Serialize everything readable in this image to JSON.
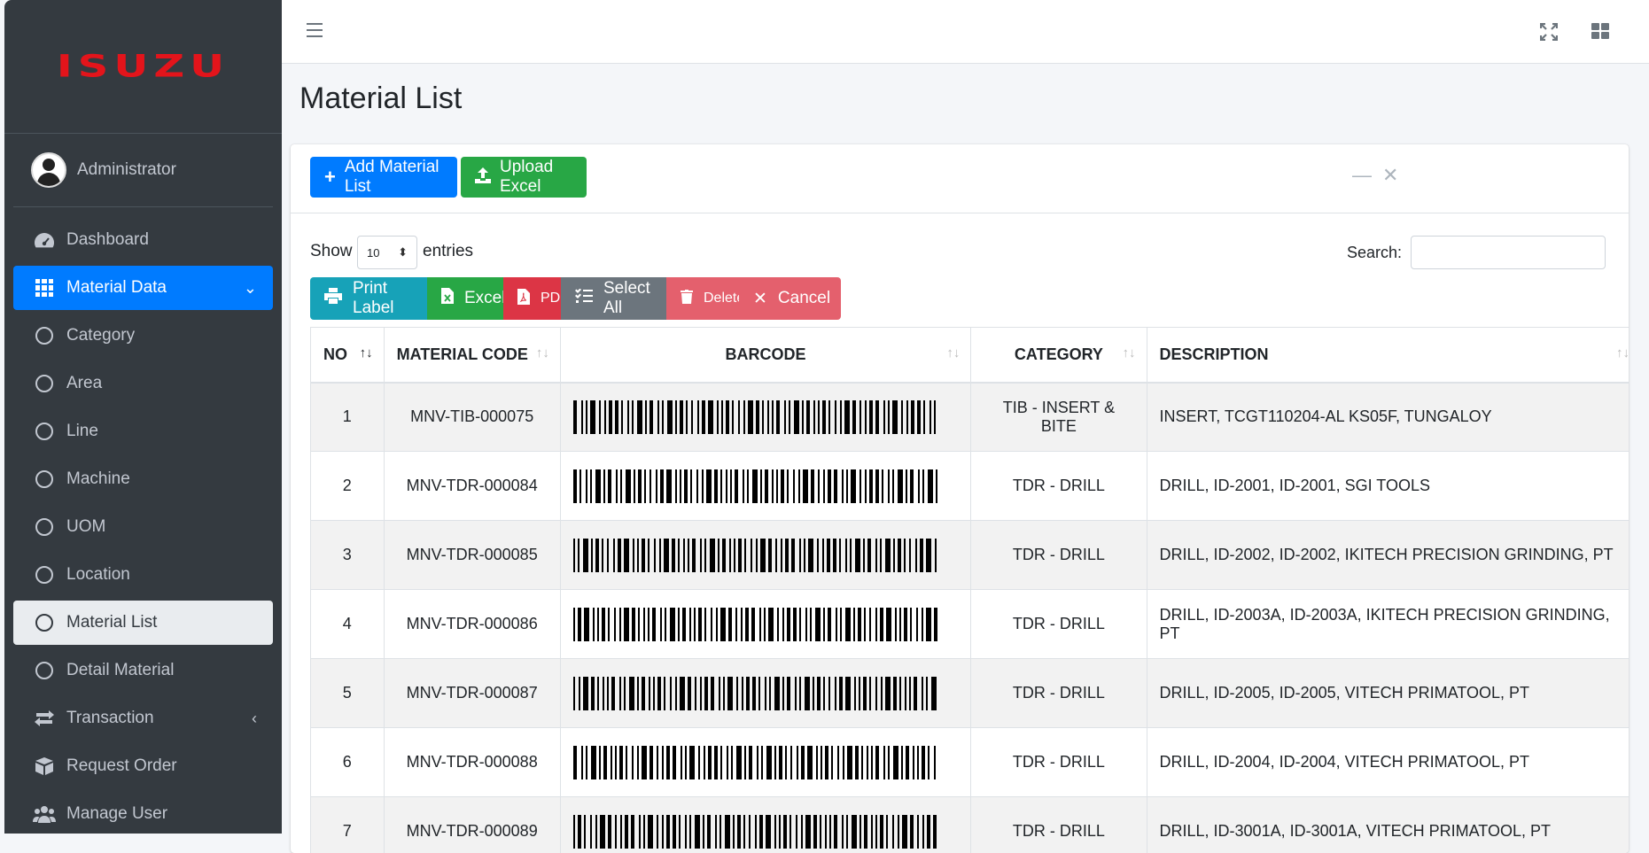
{
  "brand": {
    "logo_text": "ISUZU"
  },
  "user": {
    "name": "Administrator"
  },
  "sidebar": {
    "items": [
      {
        "label": "Dashboard",
        "icon": "tachometer-icon"
      },
      {
        "label": "Material Data",
        "icon": "grid-icon",
        "active": true
      },
      {
        "label": "Category",
        "icon": "circle-icon"
      },
      {
        "label": "Area",
        "icon": "circle-icon"
      },
      {
        "label": "Line",
        "icon": "circle-icon"
      },
      {
        "label": "Machine",
        "icon": "circle-icon"
      },
      {
        "label": "UOM",
        "icon": "circle-icon"
      },
      {
        "label": "Location",
        "icon": "circle-icon"
      },
      {
        "label": "Material List",
        "icon": "circle-icon",
        "selected": true
      },
      {
        "label": "Detail Material",
        "icon": "circle-icon"
      },
      {
        "label": "Transaction",
        "icon": "exchange-icon"
      },
      {
        "label": "Request Order",
        "icon": "box-icon"
      },
      {
        "label": "Manage User",
        "icon": "users-icon"
      }
    ]
  },
  "page": {
    "title": "Material List"
  },
  "card": {
    "add_label": "Add Material List",
    "upload_label": "Upload Excel"
  },
  "controls": {
    "show_label": "Show",
    "entries_value": "10",
    "entries_label": "entries",
    "search_label": "Search:",
    "search_value": ""
  },
  "dt_buttons": {
    "print": "Print Label",
    "excel": "Excel",
    "pdf": "PDF",
    "select_all": "Select All",
    "delete": "Delete",
    "cancel": "Cancel"
  },
  "table": {
    "headers": [
      "NO",
      "MATERIAL CODE",
      "BARCODE",
      "CATEGORY",
      "DESCRIPTION"
    ],
    "rows": [
      {
        "no": "1",
        "code": "MNV-TIB-000075",
        "category": "TIB - INSERT & BITE",
        "description": "INSERT, TCGT110204-AL KS05F, TUNGALOY"
      },
      {
        "no": "2",
        "code": "MNV-TDR-000084",
        "category": "TDR - DRILL",
        "description": "DRILL, ID-2001, ID-2001, SGI TOOLS"
      },
      {
        "no": "3",
        "code": "MNV-TDR-000085",
        "category": "TDR - DRILL",
        "description": "DRILL, ID-2002, ID-2002, IKITECH PRECISION GRINDING, PT"
      },
      {
        "no": "4",
        "code": "MNV-TDR-000086",
        "category": "TDR - DRILL",
        "description": "DRILL, ID-2003A, ID-2003A, IKITECH PRECISION GRINDING, PT"
      },
      {
        "no": "5",
        "code": "MNV-TDR-000087",
        "category": "TDR - DRILL",
        "description": "DRILL, ID-2005, ID-2005, VITECH PRIMATOOL, PT"
      },
      {
        "no": "6",
        "code": "MNV-TDR-000088",
        "category": "TDR - DRILL",
        "description": "DRILL, ID-2004, ID-2004, VITECH PRIMATOOL, PT"
      },
      {
        "no": "7",
        "code": "MNV-TDR-000089",
        "category": "TDR - DRILL",
        "description": "DRILL, ID-3001A, ID-3001A, VITECH PRIMATOOL, PT"
      }
    ]
  },
  "colors": {
    "primary": "#007bff",
    "success": "#28a745",
    "danger": "#dc3545",
    "info": "#17a2b8",
    "sidebar": "#343a40",
    "brand_red": "#e3141b"
  }
}
